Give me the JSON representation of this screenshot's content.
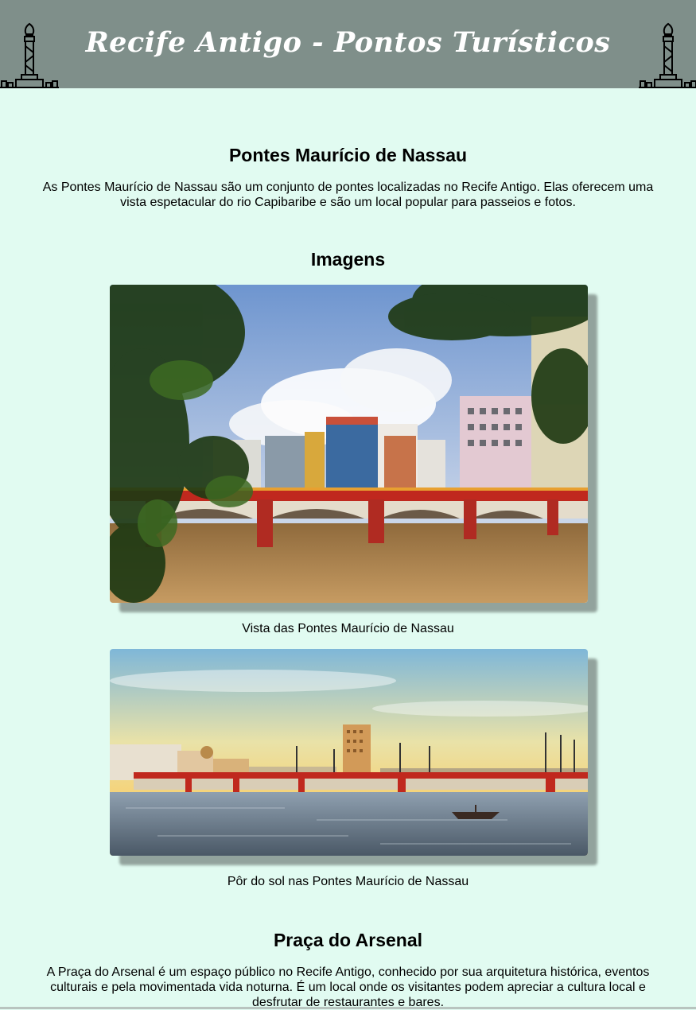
{
  "header": {
    "title": "Recife Antigo - Pontos Turísticos",
    "background_color": "#7f8f8a",
    "left_icon": "tower-icon",
    "right_icon": "tower-icon"
  },
  "sections": [
    {
      "title": "Pontes Maurício de Nassau",
      "description": "As Pontes Maurício de Nassau são um conjunto de pontes localizadas no Recife Antigo. Elas oferecem uma vista espetacular do rio Capibaribe e são um local popular para passeios e fotos."
    },
    {
      "title": "Praça do Arsenal",
      "description": "A Praça do Arsenal é um espaço público no Recife Antigo, conhecido por sua arquitetura histórica, eventos culturais e pela movimentada vida noturna. É um local onde os visitantes podem apreciar a cultura local e desfrutar de restaurantes e bares."
    }
  ],
  "gallery": {
    "title": "Imagens",
    "images": [
      {
        "caption": "Vista das Pontes Maurício de Nassau"
      },
      {
        "caption": "Pôr do sol nas Pontes Maurício de Nassau"
      }
    ]
  },
  "colors": {
    "page_background": "#e1fbf1",
    "bridge_red": "#c0281e"
  }
}
